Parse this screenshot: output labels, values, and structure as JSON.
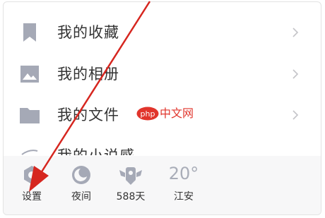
{
  "menu": {
    "items": [
      {
        "label": "我的收藏",
        "icon": "bookmark-icon"
      },
      {
        "label": "我的相册",
        "icon": "image-icon"
      },
      {
        "label": "我的文件",
        "icon": "folder-icon"
      }
    ],
    "partial_label": "我的小说感"
  },
  "bottom_bar": {
    "settings_label": "设置",
    "night_label": "夜间",
    "days_label": "588天",
    "temperature": "20°",
    "location_label": "江安"
  },
  "watermark": {
    "logo_text": "php",
    "site_text": "中文网"
  },
  "colors": {
    "icon_gray": "#a5a9b6",
    "text": "#333333",
    "chevron": "#c4c4c8",
    "arrow": "#d6261f",
    "watermark_red": "#e1352c",
    "bar_bg": "#f7f7f8"
  }
}
